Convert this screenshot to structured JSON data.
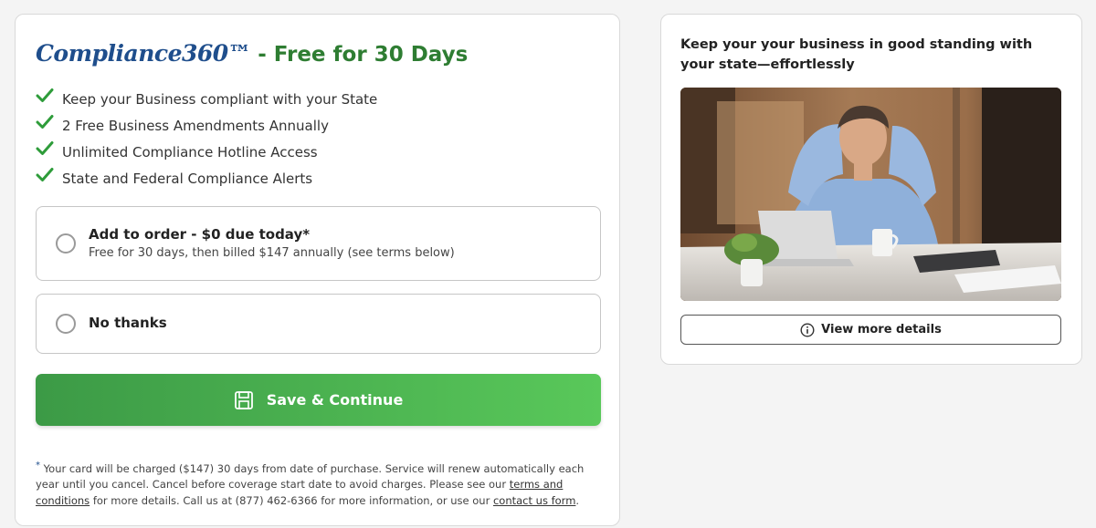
{
  "offer": {
    "brand": "Compliance360™",
    "title_suffix": "- Free for 30 Days",
    "features": [
      "Keep your Business compliant with your State",
      "2 Free Business Amendments Annually",
      "Unlimited Compliance Hotline Access",
      "State and Federal Compliance Alerts"
    ]
  },
  "options": {
    "add": {
      "title": "Add to order - $0 due today*",
      "subtitle": "Free for 30 days, then billed $147 annually (see terms below)"
    },
    "decline": {
      "title": "No thanks"
    }
  },
  "save_button": {
    "label": "Save & Continue"
  },
  "footnote": {
    "marker": "*",
    "text_1": " Your card will be charged ($147) 30 days from date of purchase. Service will renew automatically each year until you cancel. Cancel before coverage start date to avoid charges. Please see our ",
    "terms_link": "terms and conditions",
    "text_2": " for more details. Call us at (877) 462-6366 for more information, or use our ",
    "contact_link": "contact us form",
    "text_3": "."
  },
  "sidebar": {
    "heading": "Keep your your business in good standing with your state—effortlessly",
    "details_button": "View more details"
  },
  "colors": {
    "brand_blue": "#1f4e8c",
    "title_green": "#2e7d32",
    "check_green": "#2e9c3a",
    "button_green_start": "#3c9a46",
    "button_green_end": "#59c85a"
  },
  "icons": [
    "check-icon",
    "save-icon",
    "info-icon"
  ]
}
